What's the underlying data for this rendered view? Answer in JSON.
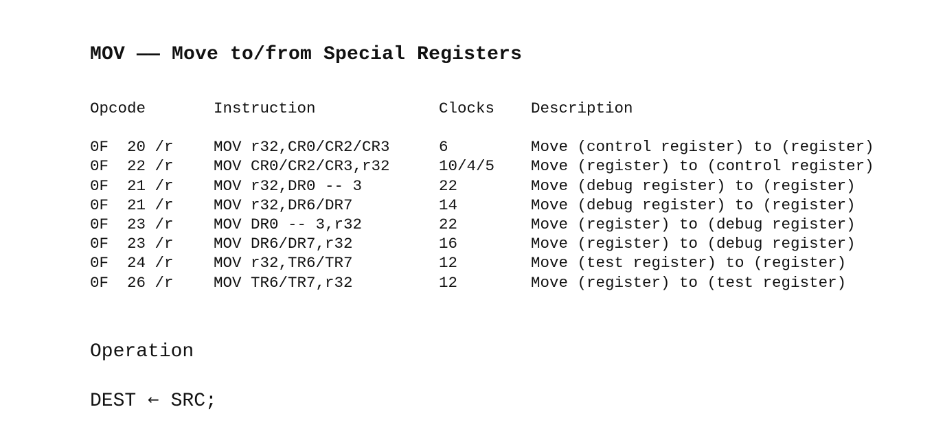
{
  "title": "MOV —— Move to/from Special Registers",
  "table": {
    "headers": {
      "opcode": "Opcode",
      "instruction": "Instruction",
      "clocks": "Clocks",
      "description": "Description"
    },
    "rows": [
      {
        "opcode": "0F  20 /r",
        "instruction": "MOV r32,CR0/CR2/CR3",
        "clocks": "6",
        "description": "Move (control register) to (register)"
      },
      {
        "opcode": "0F  22 /r",
        "instruction": "MOV CR0/CR2/CR3,r32",
        "clocks": "10/4/5",
        "description": "Move (register) to (control register)"
      },
      {
        "opcode": "0F  21 /r",
        "instruction": "MOV r32,DR0 -- 3",
        "clocks": "22",
        "description": "Move (debug register) to (register)"
      },
      {
        "opcode": "0F  21 /r",
        "instruction": "MOV r32,DR6/DR7",
        "clocks": "14",
        "description": "Move (debug register) to (register)"
      },
      {
        "opcode": "0F  23 /r",
        "instruction": "MOV DR0 -- 3,r32",
        "clocks": "22",
        "description": "Move (register) to (debug register)"
      },
      {
        "opcode": "0F  23 /r",
        "instruction": "MOV DR6/DR7,r32",
        "clocks": "16",
        "description": "Move (register) to (debug register)"
      },
      {
        "opcode": "0F  24 /r",
        "instruction": "MOV r32,TR6/TR7",
        "clocks": "12",
        "description": "Move (test register) to (register)"
      },
      {
        "opcode": "0F  26 /r",
        "instruction": "MOV TR6/TR7,r32",
        "clocks": "12",
        "description": "Move (register) to (test register)"
      }
    ]
  },
  "operation": {
    "heading": "Operation",
    "dest": "DEST",
    "arrow": "←",
    "src": "SRC;"
  }
}
